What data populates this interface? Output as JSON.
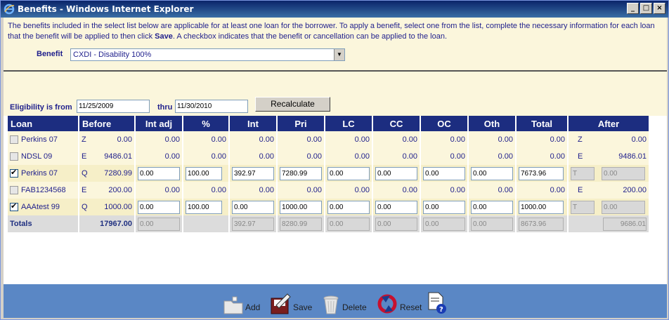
{
  "window": {
    "title": "Benefits - Windows Internet Explorer",
    "minimize": "_",
    "maximize": "□",
    "close": "×"
  },
  "info": {
    "text_before": "The benefits included in the select list below are applicable for at least one loan for the borrower. To apply a benefit, select one from the list, complete the necessary information for each loan that the benefit will be applied to then click ",
    "text_bold": "Save",
    "text_after": ". A checkbox indicates that the benefit or cancellation can be applied to the loan."
  },
  "benefit": {
    "label": "Benefit",
    "selected": "CXDI - Disability 100%"
  },
  "eligibility": {
    "label": "Eligibility is from",
    "from": "11/25/2009",
    "thru_label": "thru",
    "thru": "11/30/2010",
    "recalculate": "Recalculate"
  },
  "table": {
    "headers": [
      "Loan",
      "Before",
      "Int adj",
      "%",
      "Int",
      "Pri",
      "LC",
      "CC",
      "OC",
      "Oth",
      "Total",
      "After"
    ],
    "rows": [
      {
        "checked": false,
        "loan": "Perkins 07",
        "code": "Z",
        "before": "0.00",
        "editable": false,
        "int_adj": "0.00",
        "pct": "0.00",
        "int": "0.00",
        "pri": "0.00",
        "lc": "0.00",
        "cc": "0.00",
        "oc": "0.00",
        "oth": "0.00",
        "total": "0.00",
        "after_code": "Z",
        "after": "0.00"
      },
      {
        "checked": false,
        "loan": "NDSL 09",
        "code": "E",
        "before": "9486.01",
        "editable": false,
        "int_adj": "0.00",
        "pct": "0.00",
        "int": "0.00",
        "pri": "0.00",
        "lc": "0.00",
        "cc": "0.00",
        "oc": "0.00",
        "oth": "0.00",
        "total": "0.00",
        "after_code": "E",
        "after": "9486.01"
      },
      {
        "checked": true,
        "loan": "Perkins 07",
        "code": "Q",
        "before": "7280.99",
        "editable": true,
        "int_adj": "0.00",
        "pct": "100.00",
        "int": "392.97",
        "pri": "7280.99",
        "lc": "0.00",
        "cc": "0.00",
        "oc": "0.00",
        "oth": "0.00",
        "total": "7673.96",
        "after_code": "T",
        "after": "0.00"
      },
      {
        "checked": false,
        "loan": "FAB1234568",
        "code": "E",
        "before": "200.00",
        "editable": false,
        "int_adj": "0.00",
        "pct": "0.00",
        "int": "0.00",
        "pri": "0.00",
        "lc": "0.00",
        "cc": "0.00",
        "oc": "0.00",
        "oth": "0.00",
        "total": "0.00",
        "after_code": "E",
        "after": "200.00"
      },
      {
        "checked": true,
        "loan": "AAAtest 99",
        "code": "Q",
        "before": "1000.00",
        "editable": true,
        "int_adj": "0.00",
        "pct": "100.00",
        "int": "0.00",
        "pri": "1000.00",
        "lc": "0.00",
        "cc": "0.00",
        "oc": "0.00",
        "oth": "0.00",
        "total": "1000.00",
        "after_code": "T",
        "after": "0.00"
      }
    ],
    "totals": {
      "label": "Totals",
      "before": "17967.00",
      "int_adj": "0.00",
      "int": "392.97",
      "pri": "8280.99",
      "lc": "0.00",
      "cc": "0.00",
      "oc": "0.00",
      "oth": "0.00",
      "total": "8673.96",
      "after": "9686.01"
    }
  },
  "toolbar": {
    "add": "Add",
    "save": "Save",
    "delete": "Delete",
    "reset": "Reset"
  },
  "colors": {
    "header_bg": "#1c2d80",
    "info_bg": "#fbf6dc",
    "toolbar_bg": "#5a87c5",
    "text_blue": "#1f1f8c"
  }
}
